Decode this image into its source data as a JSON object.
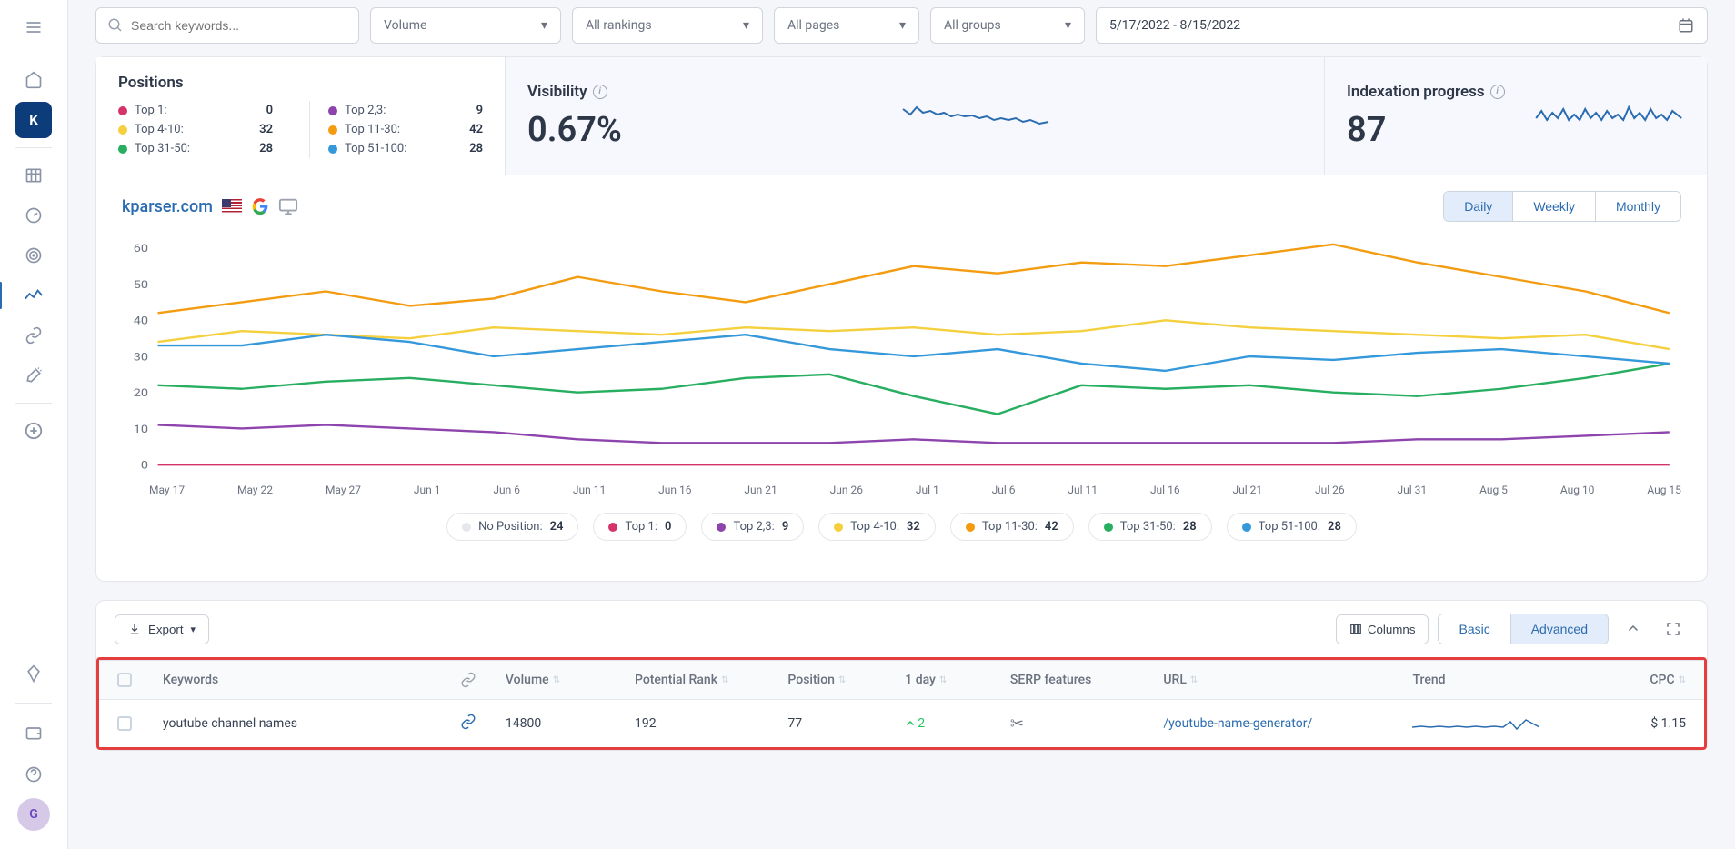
{
  "sidebar": {
    "avatar": "G"
  },
  "toolbar": {
    "search_placeholder": "Search keywords...",
    "volume": "Volume",
    "rankings": "All rankings",
    "pages": "All pages",
    "groups": "All groups",
    "daterange": "5/17/2022 - 8/15/2022"
  },
  "summary": {
    "positions_title": "Positions",
    "positions": [
      {
        "label": "Top 1:",
        "value": "0",
        "color": "#d6336c"
      },
      {
        "label": "Top 4-10:",
        "value": "32",
        "color": "#f4d03f"
      },
      {
        "label": "Top 31-50:",
        "value": "28",
        "color": "#27ae60"
      }
    ],
    "positions2": [
      {
        "label": "Top 2,3:",
        "value": "9",
        "color": "#8e44ad"
      },
      {
        "label": "Top 11-30:",
        "value": "42",
        "color": "#f39c12"
      },
      {
        "label": "Top 51-100:",
        "value": "28",
        "color": "#3498db"
      }
    ],
    "visibility_title": "Visibility",
    "visibility_value": "0.67%",
    "indexation_title": "Indexation progress",
    "indexation_value": "87"
  },
  "chart": {
    "domain": "kparser.com",
    "daily": "Daily",
    "weekly": "Weekly",
    "monthly": "Monthly"
  },
  "chart_data": {
    "type": "line",
    "ylabel": "",
    "ylim": [
      0,
      60
    ],
    "x_ticks": [
      "May 17",
      "May 22",
      "May 27",
      "Jun 1",
      "Jun 6",
      "Jun 11",
      "Jun 16",
      "Jun 21",
      "Jun 26",
      "Jul 1",
      "Jul 6",
      "Jul 11",
      "Jul 16",
      "Jul 21",
      "Jul 26",
      "Jul 31",
      "Aug 5",
      "Aug 10",
      "Aug 15"
    ],
    "series": [
      {
        "name": "Top 1",
        "color": "#d6336c",
        "values": [
          0,
          0,
          0,
          0,
          0,
          0,
          0,
          0,
          0,
          0,
          0,
          0,
          0,
          0,
          0,
          0,
          0,
          0,
          0
        ]
      },
      {
        "name": "Top 2,3",
        "color": "#8e44ad",
        "values": [
          11,
          10,
          11,
          10,
          9,
          7,
          6,
          6,
          6,
          7,
          6,
          6,
          6,
          6,
          6,
          7,
          7,
          8,
          9
        ]
      },
      {
        "name": "Top 4-10",
        "color": "#f4d03f",
        "values": [
          34,
          37,
          36,
          35,
          38,
          37,
          36,
          38,
          37,
          38,
          36,
          37,
          40,
          38,
          37,
          36,
          35,
          36,
          32
        ]
      },
      {
        "name": "Top 11-30",
        "color": "#f39c12",
        "values": [
          42,
          45,
          48,
          44,
          46,
          52,
          48,
          45,
          50,
          55,
          53,
          56,
          55,
          58,
          61,
          56,
          52,
          48,
          42
        ]
      },
      {
        "name": "Top 31-50",
        "color": "#27ae60",
        "values": [
          22,
          21,
          23,
          24,
          22,
          20,
          21,
          24,
          25,
          19,
          14,
          22,
          21,
          22,
          20,
          19,
          21,
          24,
          28
        ]
      },
      {
        "name": "Top 51-100",
        "color": "#3498db",
        "values": [
          33,
          33,
          36,
          34,
          30,
          32,
          34,
          36,
          32,
          30,
          32,
          28,
          26,
          30,
          29,
          31,
          32,
          30,
          28
        ]
      }
    ],
    "legend": [
      {
        "label": "No Position:",
        "value": "24",
        "color": "#e5e7eb"
      },
      {
        "label": "Top 1:",
        "value": "0",
        "color": "#d6336c"
      },
      {
        "label": "Top 2,3:",
        "value": "9",
        "color": "#8e44ad"
      },
      {
        "label": "Top 4-10:",
        "value": "32",
        "color": "#f4d03f"
      },
      {
        "label": "Top 11-30:",
        "value": "42",
        "color": "#f39c12"
      },
      {
        "label": "Top 31-50:",
        "value": "28",
        "color": "#27ae60"
      },
      {
        "label": "Top 51-100:",
        "value": "28",
        "color": "#3498db"
      }
    ]
  },
  "table": {
    "export": "Export",
    "columns": "Columns",
    "basic": "Basic",
    "advanced": "Advanced",
    "headers": {
      "keywords": "Keywords",
      "volume": "Volume",
      "potential": "Potential Rank",
      "position": "Position",
      "day1": "1 day",
      "serp": "SERP features",
      "url": "URL",
      "trend": "Trend",
      "cpc": "CPC"
    },
    "rows": [
      {
        "keyword": "youtube channel names",
        "volume": "14800",
        "potential": "192",
        "position": "77",
        "day1": "2",
        "url": "/youtube-name-generator/",
        "cpc": "$ 1.15"
      }
    ]
  }
}
